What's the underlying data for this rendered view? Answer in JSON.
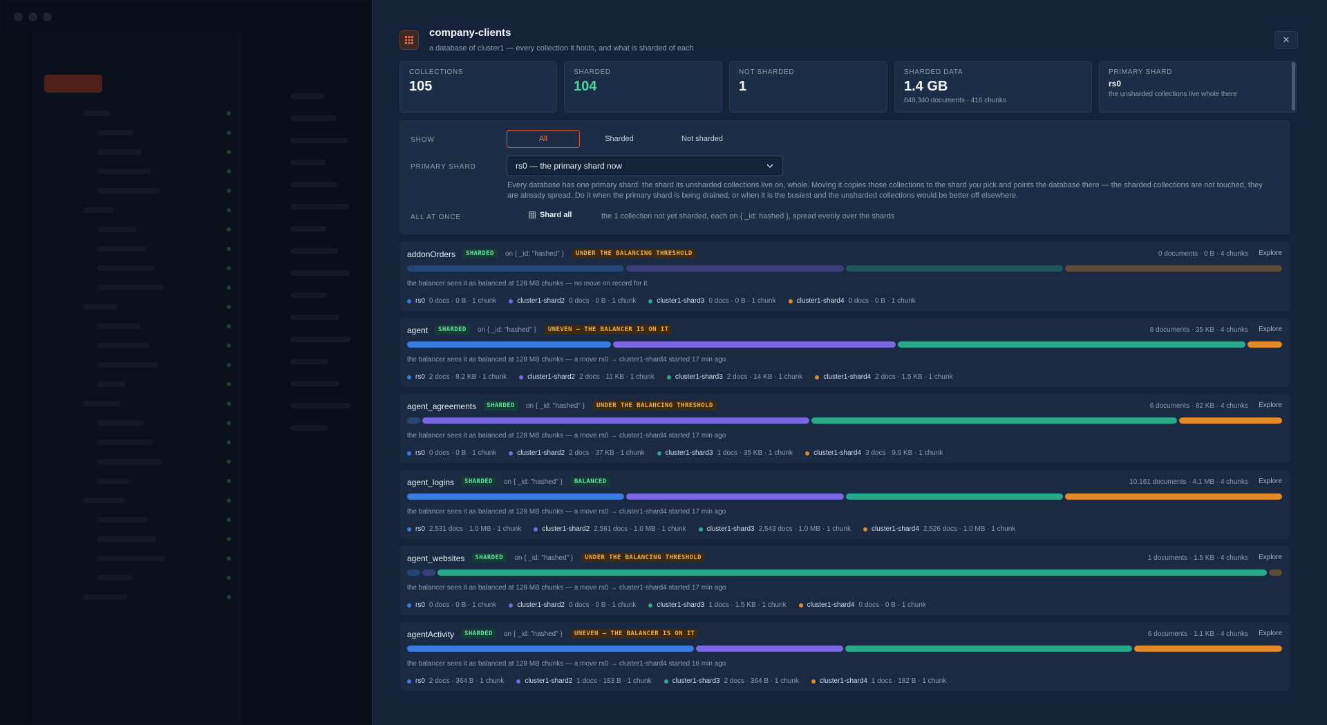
{
  "window": {
    "title": "company-clients"
  },
  "header": {
    "title": "company-clients",
    "subtitle": "a database of cluster1 — every collection it holds, and what is sharded of each",
    "icon": "database-icon",
    "close_icon": "close-icon"
  },
  "stats": [
    {
      "label": "COLLECTIONS",
      "value": "105",
      "note": ""
    },
    {
      "label": "SHARDED",
      "value": "104",
      "note": ""
    },
    {
      "label": "NOT SHARDED",
      "value": "1",
      "note": ""
    },
    {
      "label": "SHARDED DATA",
      "value": "1.4 GB",
      "note": "848,340 documents · 416 chunks"
    },
    {
      "label": "PRIMARY SHARD",
      "value": "rs0",
      "note": "the unsharded collections live whole there"
    }
  ],
  "filters": {
    "show_label": "SHOW",
    "show_options": [
      "All",
      "Sharded",
      "Not sharded"
    ],
    "primary_label": "PRIMARY SHARD",
    "primary_value": "rs0 — the primary shard now",
    "primary_desc": "Every database has one primary shard: the shard its unsharded collections live on, whole. Moving it copies those collections to the shard you pick and points the database there — the sharded collections are not touched, they are already spread. Do it when the primary shard is being drained, or when it is the busiest and the unsharded collections would be better off elsewhere.",
    "all_label": "ALL AT ONCE",
    "shard_all_button": "Shard all",
    "shard_all_note": "the 1 collection not yet sharded, each on { _id: hashed }, spread evenly over the shards"
  },
  "colors": {
    "rs0": "#3a7be0",
    "cluster1-shard2": "#7a68e0",
    "cluster1-shard3": "#2aa88a",
    "cluster1-shard4": "#e08a2a",
    "accent": "#d9533a"
  },
  "collections": [
    {
      "name": "addonOrders",
      "badge": "SHARDED",
      "key": "on { _id: \"hashed\" }",
      "status": "UNDER THE BALANCING THRESHOLD",
      "meta": "0 documents · 0 B · 4 chunks",
      "explore": "Explore",
      "note": "the balancer sees it as balanced at 128 MB chunks — no move on record for it",
      "shards": [
        {
          "name": "rs0",
          "info": "0 docs · 0 B · 1 chunk",
          "share": 0.25,
          "dim": true
        },
        {
          "name": "cluster1-shard2",
          "info": "0 docs · 0 B · 1 chunk",
          "share": 0.25,
          "dim": true
        },
        {
          "name": "cluster1-shard3",
          "info": "0 docs · 0 B · 1 chunk",
          "share": 0.25,
          "dim": true
        },
        {
          "name": "cluster1-shard4",
          "info": "0 docs · 0 B · 1 chunk",
          "share": 0.25,
          "dim": true
        }
      ]
    },
    {
      "name": "agent",
      "badge": "SHARDED",
      "key": "on { _id: \"hashed\" }",
      "status": "UNEVEN — THE BALANCER IS ON IT",
      "meta": "8 documents · 35 KB · 4 chunks",
      "explore": "Explore",
      "note": "the balancer sees it as balanced at 128 MB chunks — a move rs0 → cluster1-shard4 started 17 min ago",
      "shards": [
        {
          "name": "rs0",
          "info": "2 docs · 8.2 KB · 1 chunk",
          "share": 0.235,
          "dim": false
        },
        {
          "name": "cluster1-shard2",
          "info": "2 docs · 11 KB · 1 chunk",
          "share": 0.325,
          "dim": false
        },
        {
          "name": "cluster1-shard3",
          "info": "2 docs · 14 KB · 1 chunk",
          "share": 0.4,
          "dim": false
        },
        {
          "name": "cluster1-shard4",
          "info": "2 docs · 1.5 KB · 1 chunk",
          "share": 0.04,
          "dim": false
        }
      ]
    },
    {
      "name": "agent_agreements",
      "badge": "SHARDED",
      "key": "on { _id: \"hashed\" }",
      "status": "UNDER THE BALANCING THRESHOLD",
      "meta": "6 documents · 82 KB · 4 chunks",
      "explore": "Explore",
      "note": "the balancer sees it as balanced at 128 MB chunks — a move rs0 → cluster1-shard4 started 17 min ago",
      "shards": [
        {
          "name": "rs0",
          "info": "0 docs · 0 B · 1 chunk",
          "share": 0.015,
          "dim": true
        },
        {
          "name": "cluster1-shard2",
          "info": "2 docs · 37 KB · 1 chunk",
          "share": 0.45,
          "dim": false
        },
        {
          "name": "cluster1-shard3",
          "info": "1 docs · 35 KB · 1 chunk",
          "share": 0.425,
          "dim": false
        },
        {
          "name": "cluster1-shard4",
          "info": "3 docs · 9.9 KB · 1 chunk",
          "share": 0.12,
          "dim": false
        }
      ]
    },
    {
      "name": "agent_logins",
      "badge": "SHARDED",
      "key": "on { _id: \"hashed\" }",
      "status": "BALANCED",
      "meta": "10,161 documents · 4.1 MB · 4 chunks",
      "explore": "Explore",
      "note": "the balancer sees it as balanced at 128 MB chunks — a move rs0 → cluster1-shard4 started 17 min ago",
      "shards": [
        {
          "name": "rs0",
          "info": "2,531 docs · 1.0 MB · 1 chunk",
          "share": 0.25,
          "dim": false
        },
        {
          "name": "cluster1-shard2",
          "info": "2,561 docs · 1.0 MB · 1 chunk",
          "share": 0.25,
          "dim": false
        },
        {
          "name": "cluster1-shard3",
          "info": "2,543 docs · 1.0 MB · 1 chunk",
          "share": 0.25,
          "dim": false
        },
        {
          "name": "cluster1-shard4",
          "info": "2,526 docs · 1.0 MB · 1 chunk",
          "share": 0.25,
          "dim": false
        }
      ]
    },
    {
      "name": "agent_websites",
      "badge": "SHARDED",
      "key": "on { _id: \"hashed\" }",
      "status": "UNDER THE BALANCING THRESHOLD",
      "meta": "1 documents · 1.5 KB · 4 chunks",
      "explore": "Explore",
      "note": "the balancer sees it as balanced at 128 MB chunks — a move rs0 → cluster1-shard4 started 17 min ago",
      "shards": [
        {
          "name": "rs0",
          "info": "0 docs · 0 B · 1 chunk",
          "share": 0.015,
          "dim": true
        },
        {
          "name": "cluster1-shard2",
          "info": "0 docs · 0 B · 1 chunk",
          "share": 0.015,
          "dim": true
        },
        {
          "name": "cluster1-shard3",
          "info": "1 docs · 1.5 KB · 1 chunk",
          "share": 0.955,
          "dim": false
        },
        {
          "name": "cluster1-shard4",
          "info": "0 docs · 0 B · 1 chunk",
          "share": 0.015,
          "dim": true
        }
      ]
    },
    {
      "name": "agentActivity",
      "badge": "SHARDED",
      "key": "on { _id: \"hashed\" }",
      "status": "UNEVEN — THE BALANCER IS ON IT",
      "meta": "6 documents · 1.1 KB · 4 chunks",
      "explore": "Explore",
      "note": "the balancer sees it as balanced at 128 MB chunks — a move rs0 → cluster1-shard4 started 16 min ago",
      "shards": [
        {
          "name": "rs0",
          "info": "2 docs · 364 B · 1 chunk",
          "share": 0.33,
          "dim": false
        },
        {
          "name": "cluster1-shard2",
          "info": "1 docs · 183 B · 1 chunk",
          "share": 0.17,
          "dim": false
        },
        {
          "name": "cluster1-shard3",
          "info": "2 docs · 364 B · 1 chunk",
          "share": 0.33,
          "dim": false
        },
        {
          "name": "cluster1-shard4",
          "info": "1 docs · 182 B · 1 chunk",
          "share": 0.17,
          "dim": false
        }
      ]
    }
  ]
}
